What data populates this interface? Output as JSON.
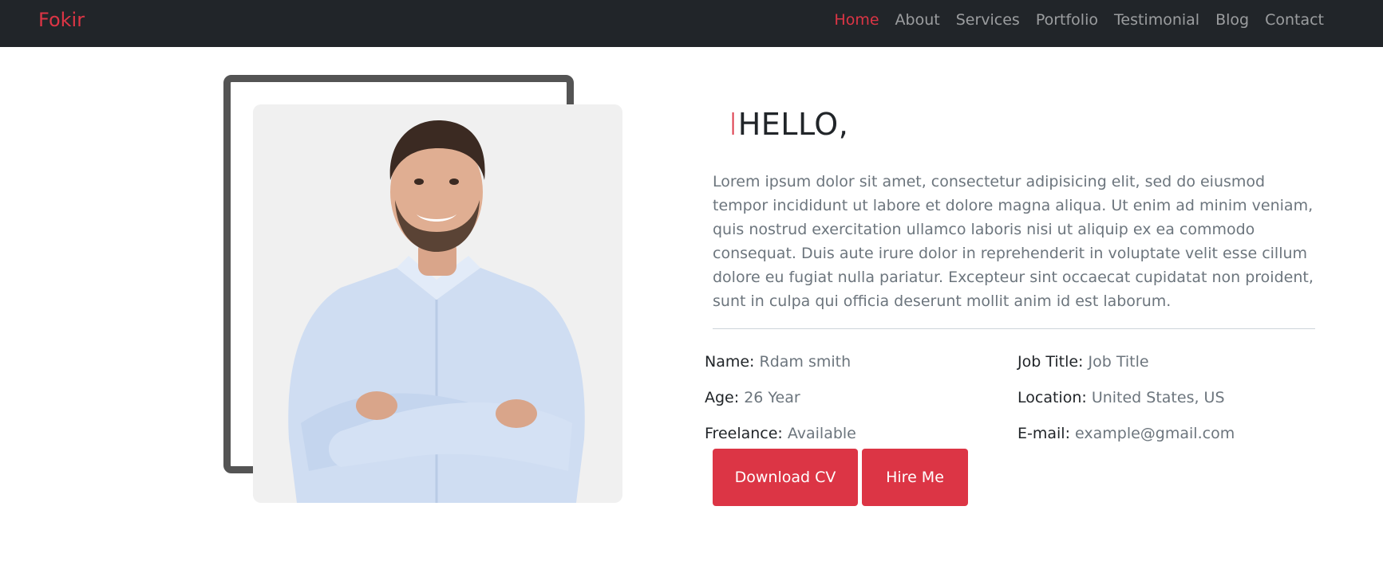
{
  "colors": {
    "accent": "#dc3545",
    "navbar_bg": "#212529",
    "muted_text": "#6c757d",
    "frame": "#545454"
  },
  "navbar": {
    "brand": "Fokir",
    "links": [
      "Home",
      "About",
      "Services",
      "Portfolio",
      "Testimonial",
      "Blog",
      "Contact"
    ],
    "active": "Home"
  },
  "about": {
    "heading_cursor": "I",
    "heading": "HELLO,",
    "bio": "Lorem ipsum dolor sit amet, consectetur adipisicing elit, sed do eiusmod tempor incididunt ut labore et dolore magna aliqua. Ut enim ad minim veniam, quis nostrud exercitation ullamco laboris nisi ut aliquip ex ea commodo consequat. Duis aute irure dolor in reprehenderit in voluptate velit esse cillum dolore eu fugiat nulla pariatur. Excepteur sint occaecat cupidatat non proident, sunt in culpa qui officia deserunt mollit anim id est laborum.",
    "info": [
      {
        "label": "Name:",
        "value": "Rdam smith"
      },
      {
        "label": "Job Title:",
        "value": "Job Title"
      },
      {
        "label": "Age:",
        "value": "26 Year"
      },
      {
        "label": "Location:",
        "value": "United States, US"
      },
      {
        "label": "Freelance:",
        "value": "Available"
      },
      {
        "label": "E-mail:",
        "value": "example@gmail.com"
      }
    ],
    "buttons": {
      "download_cv": "Download CV",
      "hire_me": "Hire Me"
    }
  }
}
